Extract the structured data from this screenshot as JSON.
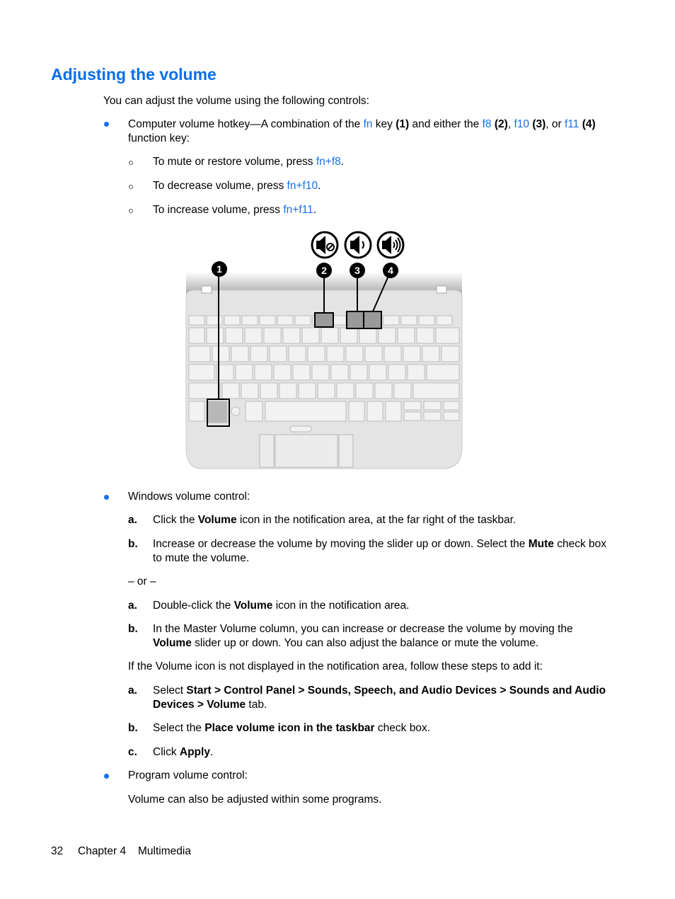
{
  "page": {
    "title": "Adjusting the volume",
    "intro": "You can adjust the volume using the following controls:",
    "hotkey_section": {
      "t1": "Computer volume hotkey—A combination of the ",
      "fn": "fn",
      "t2": " key ",
      "n1": "(1)",
      "t3": " and either the ",
      "f8": "f8",
      "n2": "(2)",
      "t4": ", ",
      "f10": "f10",
      "n3": "(3)",
      "t5": ", or ",
      "f11": "f11",
      "n4": "(4)",
      "t6": "function key:",
      "sub_items": [
        {
          "text": "To mute or restore volume, press ",
          "key": "fn+f8",
          "end": "."
        },
        {
          "text": "To decrease volume, press ",
          "key": "fn+f10",
          "end": "."
        },
        {
          "text": "To increase volume, press ",
          "key": "fn+f11",
          "end": "."
        }
      ]
    },
    "figure": {
      "icons": [
        "mute-icon",
        "volume-down-icon",
        "volume-up-icon"
      ],
      "callouts": [
        "1",
        "2",
        "3",
        "4"
      ]
    },
    "windows_section": {
      "heading": "Windows volume control:",
      "steps_a": [
        {
          "label": "a.",
          "pre": "Click the ",
          "bold": "Volume",
          "post": " icon in the notification area, at the far right of the taskbar."
        },
        {
          "label": "b.",
          "pre": "Increase or decrease the volume by moving the slider up or down. Select the ",
          "bold": "Mute",
          "post": " check box",
          "line2": "to mute the volume."
        }
      ],
      "or": "– or –",
      "steps_b": [
        {
          "label": "a.",
          "pre": "Double-click the ",
          "bold": "Volume",
          "post": " icon in the notification area."
        },
        {
          "label": "b.",
          "line1": "In the Master Volume column, you can increase or decrease the volume by moving the",
          "bold": "Volume",
          "post": " slider up or down. You can also adjust the balance or mute the volume."
        }
      ],
      "if_text": "If the Volume icon is not displayed in the notification area, follow these steps to add it:",
      "steps_c": [
        {
          "label": "a.",
          "pre": "Select ",
          "bold": "Start > Control Panel > Sounds, Speech, and Audio Devices > Sounds and Audio",
          "bold2": "Devices > Volume",
          "post": " tab."
        },
        {
          "label": "b.",
          "pre": "Select the ",
          "bold": "Place volume icon in the taskbar",
          "post": " check box."
        },
        {
          "label": "c.",
          "pre": "Click ",
          "bold": "Apply",
          "post": "."
        }
      ]
    },
    "program_section": {
      "heading": "Program volume control:",
      "text": "Volume can also be adjusted within some programs."
    },
    "footer": {
      "page_number": "32",
      "chapter": "Chapter 4",
      "section": "Multimedia"
    }
  }
}
